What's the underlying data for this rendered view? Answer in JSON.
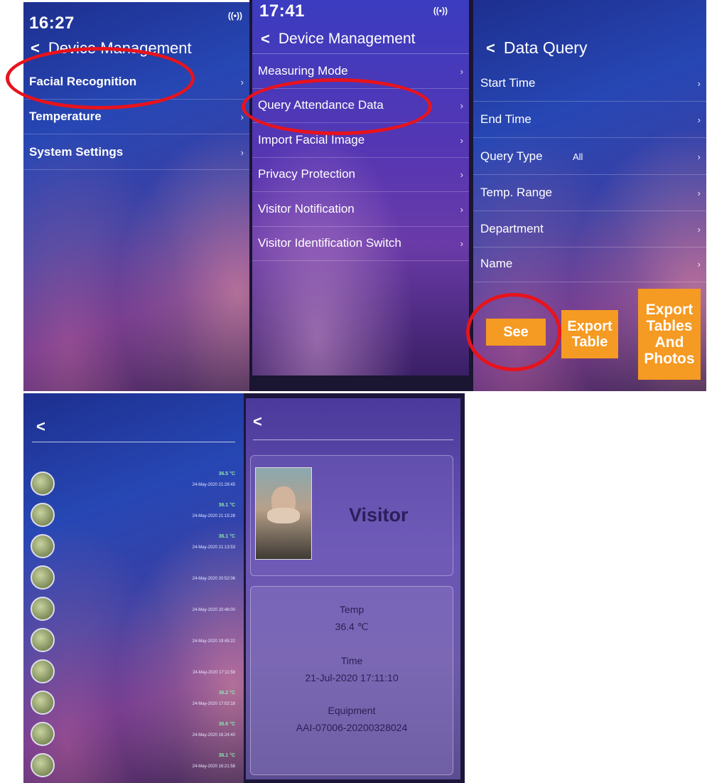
{
  "panel1": {
    "time": "16:27",
    "title": "Device Management",
    "items": [
      "Facial Recognition",
      "Temperature",
      "System Settings"
    ]
  },
  "panel2": {
    "time": "17:41",
    "title": "Device Management",
    "items": [
      "Measuring Mode",
      "Query Attendance Data",
      "Import Facial Image",
      "Privacy Protection",
      "Visitor Notification",
      "Visitor Identification Switch"
    ]
  },
  "panel3": {
    "title": "Data Query",
    "items": [
      {
        "label": "Start Time",
        "value": ""
      },
      {
        "label": "End Time",
        "value": ""
      },
      {
        "label": "Query Type",
        "value": "All"
      },
      {
        "label": "Temp. Range",
        "value": ""
      },
      {
        "label": "Department",
        "value": ""
      },
      {
        "label": "Name",
        "value": ""
      }
    ],
    "buttons": {
      "see": "See",
      "export_table": "Export Table",
      "export_tables_photos": "Export Tables And Photos"
    }
  },
  "panel4": {
    "entries": [
      {
        "temp": "36.5 °C",
        "date": "24-May-2020 21:28:45"
      },
      {
        "temp": "36.1 °C",
        "date": "24-May-2020 21:15:28"
      },
      {
        "temp": "36.1 °C",
        "date": "24-May-2020 21:13:53"
      },
      {
        "temp": "",
        "date": "24-May-2020 20:52:06"
      },
      {
        "temp": "",
        "date": "24-May-2020 20:46:00"
      },
      {
        "temp": "",
        "date": "24-May-2020 19:45:22"
      },
      {
        "temp": "",
        "date": "24-May-2020 17:11:58"
      },
      {
        "temp": "36.2 °C",
        "date": "24-May-2020 17:02:18"
      },
      {
        "temp": "36.6 °C",
        "date": "24-May-2020 16:24:40"
      },
      {
        "temp": "36.1 °C",
        "date": "24-May-2020 16:21:58"
      }
    ]
  },
  "panel5": {
    "label": "Visitor",
    "temp_label": "Temp",
    "temp_value": "36.4 ℃",
    "time_label": "Time",
    "time_value": "21-Jul-2020 17:11:10",
    "equipment_label": "Equipment",
    "equipment_value": "AAI-07006-20200328024"
  },
  "icons": {
    "back": "back-chevron-icon",
    "arrow": "chevron-right-icon",
    "signal": "wifi-signal-icon"
  }
}
